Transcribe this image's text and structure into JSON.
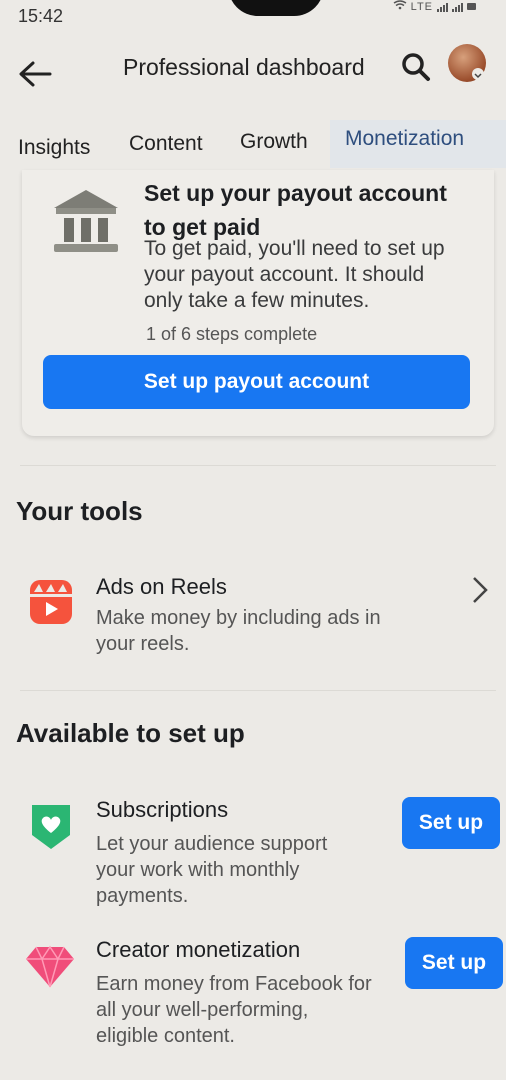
{
  "status_bar": {
    "time": "15:42",
    "network": "LTE"
  },
  "header": {
    "title": "Professional dashboard"
  },
  "tabs": [
    {
      "label": "Insights"
    },
    {
      "label": "Content"
    },
    {
      "label": "Growth"
    },
    {
      "label": "Monetization"
    }
  ],
  "payout": {
    "title": "Set up your payout account to get paid",
    "description": "To get paid, you'll need to set up your payout account. It should only take a few minutes.",
    "steps": "1 of 6 steps complete",
    "button_label": "Set up payout account"
  },
  "your_tools": {
    "heading": "Your tools",
    "items": [
      {
        "title": "Ads on Reels",
        "description": "Make money by including ads in your reels."
      }
    ]
  },
  "available": {
    "heading": "Available to set up",
    "items": [
      {
        "title": "Subscriptions",
        "description": "Let your audience support your work with monthly payments.",
        "button_label": "Set up"
      },
      {
        "title": "Creator monetization",
        "description": "Earn money from Facebook for all your well-performing, eligible content.",
        "button_label": "Set up"
      }
    ]
  },
  "colors": {
    "primary": "#1877f2",
    "active_tab": "#2e4e7e",
    "reels": "#f5533d",
    "subscriptions": "#2bb673",
    "diamond": "#f04d7a"
  }
}
